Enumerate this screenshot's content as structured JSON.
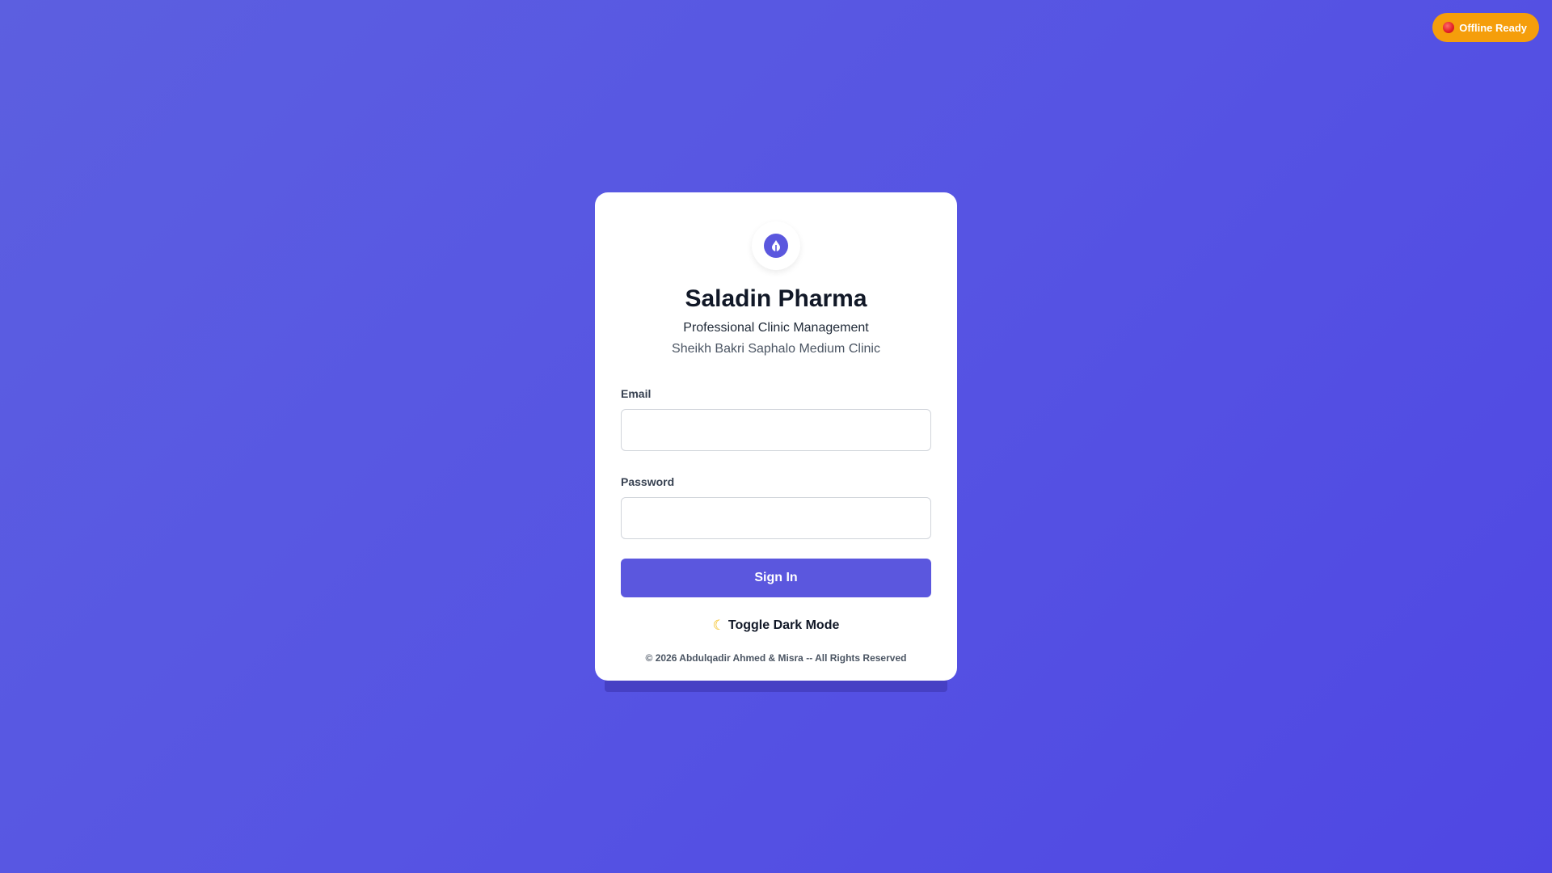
{
  "badge": {
    "label": "Offline Ready",
    "color": "#f59e0b",
    "dot_color": "#e11d26"
  },
  "brand": {
    "logo_icon": "drop-icon",
    "accent": "#5b57de",
    "title": "Saladin Pharma",
    "subtitle": "Professional Clinic Management",
    "clinic": "Sheikh Bakri Saphalo Medium Clinic"
  },
  "form": {
    "email_label": "Email",
    "email_value": "",
    "password_label": "Password",
    "password_value": "",
    "submit_label": "Sign In"
  },
  "toggle": {
    "icon": "moon-icon",
    "label": "Toggle Dark Mode"
  },
  "footer": {
    "text": "© 2026 Abdulqadir Ahmed & Misra -- All Rights Reserved"
  }
}
